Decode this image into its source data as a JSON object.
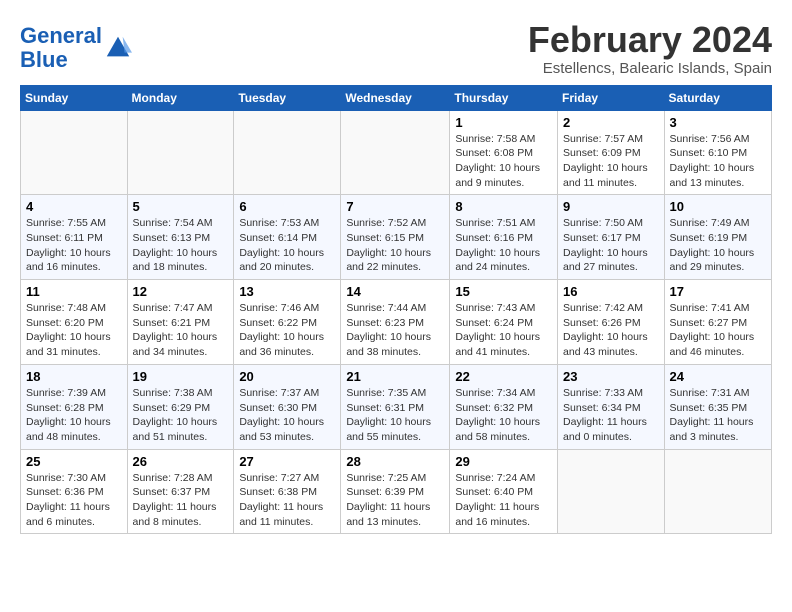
{
  "header": {
    "logo_line1": "General",
    "logo_line2": "Blue",
    "month": "February 2024",
    "location": "Estellencs, Balearic Islands, Spain"
  },
  "weekdays": [
    "Sunday",
    "Monday",
    "Tuesday",
    "Wednesday",
    "Thursday",
    "Friday",
    "Saturday"
  ],
  "weeks": [
    [
      {
        "day": "",
        "info": ""
      },
      {
        "day": "",
        "info": ""
      },
      {
        "day": "",
        "info": ""
      },
      {
        "day": "",
        "info": ""
      },
      {
        "day": "1",
        "info": "Sunrise: 7:58 AM\nSunset: 6:08 PM\nDaylight: 10 hours and 9 minutes."
      },
      {
        "day": "2",
        "info": "Sunrise: 7:57 AM\nSunset: 6:09 PM\nDaylight: 10 hours and 11 minutes."
      },
      {
        "day": "3",
        "info": "Sunrise: 7:56 AM\nSunset: 6:10 PM\nDaylight: 10 hours and 13 minutes."
      }
    ],
    [
      {
        "day": "4",
        "info": "Sunrise: 7:55 AM\nSunset: 6:11 PM\nDaylight: 10 hours and 16 minutes."
      },
      {
        "day": "5",
        "info": "Sunrise: 7:54 AM\nSunset: 6:13 PM\nDaylight: 10 hours and 18 minutes."
      },
      {
        "day": "6",
        "info": "Sunrise: 7:53 AM\nSunset: 6:14 PM\nDaylight: 10 hours and 20 minutes."
      },
      {
        "day": "7",
        "info": "Sunrise: 7:52 AM\nSunset: 6:15 PM\nDaylight: 10 hours and 22 minutes."
      },
      {
        "day": "8",
        "info": "Sunrise: 7:51 AM\nSunset: 6:16 PM\nDaylight: 10 hours and 24 minutes."
      },
      {
        "day": "9",
        "info": "Sunrise: 7:50 AM\nSunset: 6:17 PM\nDaylight: 10 hours and 27 minutes."
      },
      {
        "day": "10",
        "info": "Sunrise: 7:49 AM\nSunset: 6:19 PM\nDaylight: 10 hours and 29 minutes."
      }
    ],
    [
      {
        "day": "11",
        "info": "Sunrise: 7:48 AM\nSunset: 6:20 PM\nDaylight: 10 hours and 31 minutes."
      },
      {
        "day": "12",
        "info": "Sunrise: 7:47 AM\nSunset: 6:21 PM\nDaylight: 10 hours and 34 minutes."
      },
      {
        "day": "13",
        "info": "Sunrise: 7:46 AM\nSunset: 6:22 PM\nDaylight: 10 hours and 36 minutes."
      },
      {
        "day": "14",
        "info": "Sunrise: 7:44 AM\nSunset: 6:23 PM\nDaylight: 10 hours and 38 minutes."
      },
      {
        "day": "15",
        "info": "Sunrise: 7:43 AM\nSunset: 6:24 PM\nDaylight: 10 hours and 41 minutes."
      },
      {
        "day": "16",
        "info": "Sunrise: 7:42 AM\nSunset: 6:26 PM\nDaylight: 10 hours and 43 minutes."
      },
      {
        "day": "17",
        "info": "Sunrise: 7:41 AM\nSunset: 6:27 PM\nDaylight: 10 hours and 46 minutes."
      }
    ],
    [
      {
        "day": "18",
        "info": "Sunrise: 7:39 AM\nSunset: 6:28 PM\nDaylight: 10 hours and 48 minutes."
      },
      {
        "day": "19",
        "info": "Sunrise: 7:38 AM\nSunset: 6:29 PM\nDaylight: 10 hours and 51 minutes."
      },
      {
        "day": "20",
        "info": "Sunrise: 7:37 AM\nSunset: 6:30 PM\nDaylight: 10 hours and 53 minutes."
      },
      {
        "day": "21",
        "info": "Sunrise: 7:35 AM\nSunset: 6:31 PM\nDaylight: 10 hours and 55 minutes."
      },
      {
        "day": "22",
        "info": "Sunrise: 7:34 AM\nSunset: 6:32 PM\nDaylight: 10 hours and 58 minutes."
      },
      {
        "day": "23",
        "info": "Sunrise: 7:33 AM\nSunset: 6:34 PM\nDaylight: 11 hours and 0 minutes."
      },
      {
        "day": "24",
        "info": "Sunrise: 7:31 AM\nSunset: 6:35 PM\nDaylight: 11 hours and 3 minutes."
      }
    ],
    [
      {
        "day": "25",
        "info": "Sunrise: 7:30 AM\nSunset: 6:36 PM\nDaylight: 11 hours and 6 minutes."
      },
      {
        "day": "26",
        "info": "Sunrise: 7:28 AM\nSunset: 6:37 PM\nDaylight: 11 hours and 8 minutes."
      },
      {
        "day": "27",
        "info": "Sunrise: 7:27 AM\nSunset: 6:38 PM\nDaylight: 11 hours and 11 minutes."
      },
      {
        "day": "28",
        "info": "Sunrise: 7:25 AM\nSunset: 6:39 PM\nDaylight: 11 hours and 13 minutes."
      },
      {
        "day": "29",
        "info": "Sunrise: 7:24 AM\nSunset: 6:40 PM\nDaylight: 11 hours and 16 minutes."
      },
      {
        "day": "",
        "info": ""
      },
      {
        "day": "",
        "info": ""
      }
    ]
  ]
}
